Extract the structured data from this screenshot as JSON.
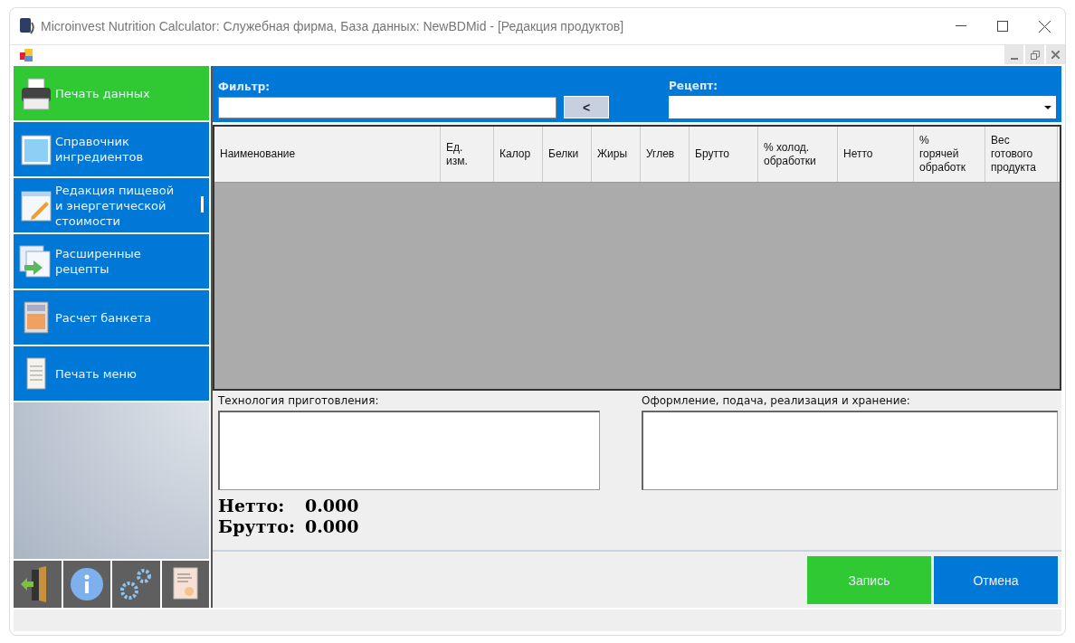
{
  "window": {
    "title": "Microinvest Nutrition Calculator: Служебная фирма, База данных: NewBDMid - [Редакция продуктов]"
  },
  "sidebar": {
    "items": [
      {
        "label": "Печать данных",
        "selected": true,
        "marker": false
      },
      {
        "label": "Справочник ингредиентов",
        "selected": false,
        "marker": false
      },
      {
        "label": "Редакция пищевой и энергетической стоимости",
        "selected": false,
        "marker": true
      },
      {
        "label": "Расширенные рецепты",
        "selected": false,
        "marker": false
      },
      {
        "label": "Расчет банкета",
        "selected": false,
        "marker": false
      },
      {
        "label": "Печать меню",
        "selected": false,
        "marker": false
      }
    ]
  },
  "filter": {
    "label": "Фильтр:",
    "button": "<"
  },
  "recipe": {
    "label": "Рецепт:"
  },
  "table": {
    "columns": [
      "Наименование",
      "Ед.\nизм.",
      "Калор",
      "Белки",
      "Жиры",
      "Углев",
      "Брутто",
      "% холод.\nобработки",
      "Нетто",
      "%\nгорячей\nобработк",
      "Вес\nготового\nпродукта"
    ]
  },
  "notes": [
    {
      "label": "Технология приготовления:"
    },
    {
      "label": "Оформление, подача, реализация и хранение:"
    }
  ],
  "totals": [
    {
      "label": "Нетто:",
      "value": "0.000"
    },
    {
      "label": "Брутто:",
      "value": "0.000"
    }
  ],
  "buttons": [
    {
      "label": "Запись",
      "kind": "primary"
    },
    {
      "label": "Отмена",
      "kind": "secondary"
    }
  ]
}
